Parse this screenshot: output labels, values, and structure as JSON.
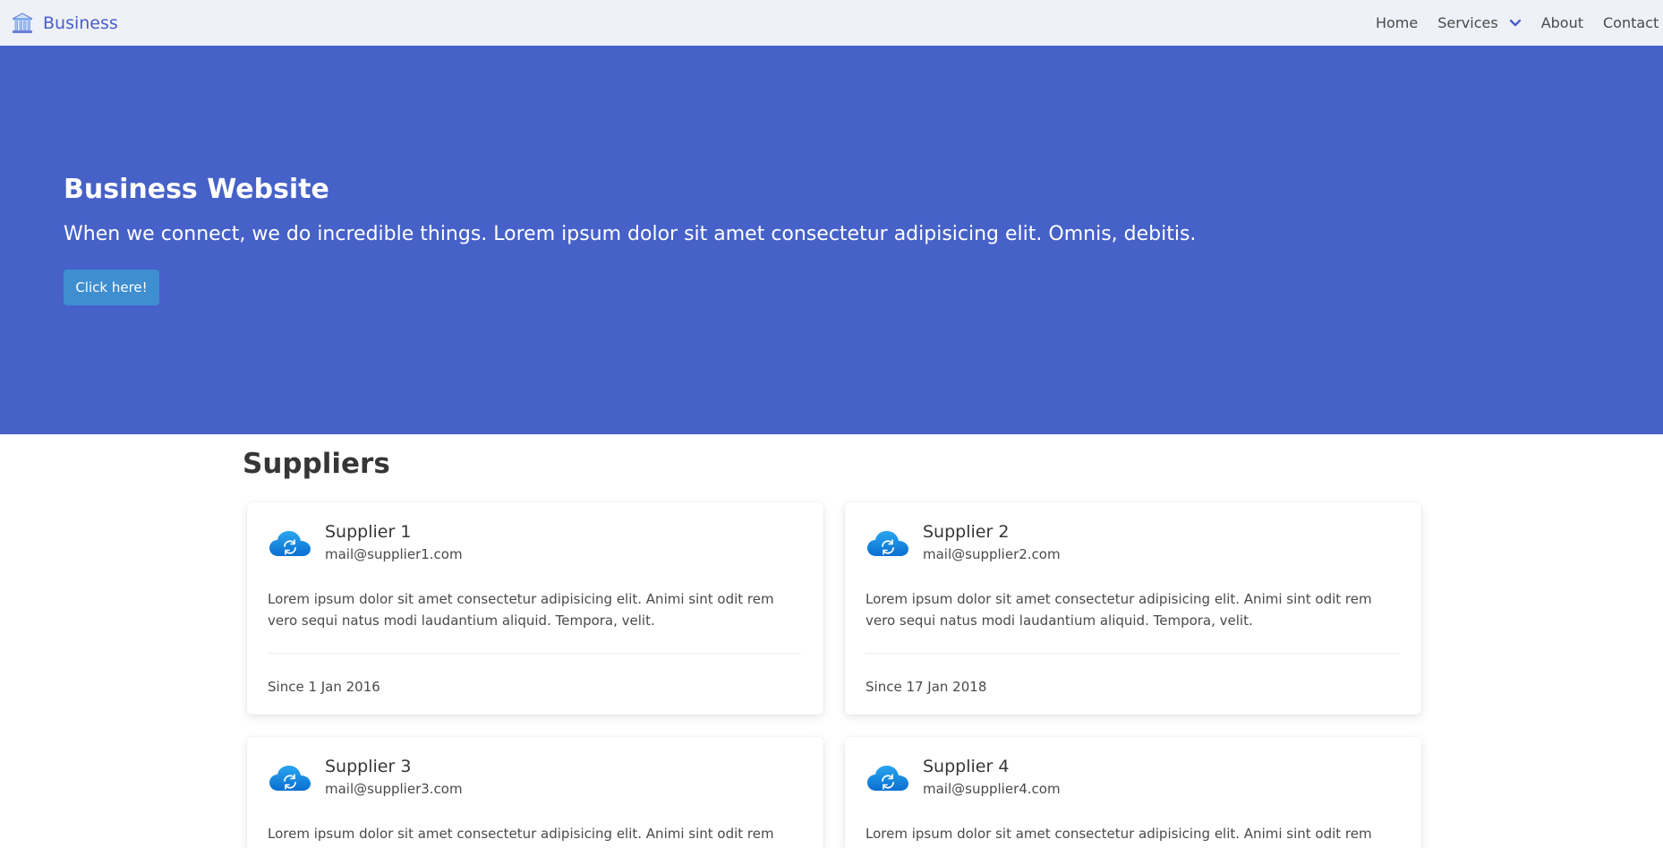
{
  "navbar": {
    "brand": "Business",
    "items": [
      {
        "label": "Home"
      },
      {
        "label": "Services"
      },
      {
        "label": "About"
      },
      {
        "label": "Contact"
      }
    ]
  },
  "hero": {
    "title": "Business Website",
    "subtitle": "When we connect, we do incredible things. Lorem ipsum dolor sit amet consectetur adipisicing elit. Omnis, debitis.",
    "button_label": "Click here!"
  },
  "suppliers": {
    "title": "Suppliers",
    "cards": [
      {
        "name": "Supplier 1",
        "email": "mail@supplier1.com",
        "description": "Lorem ipsum dolor sit amet consectetur adipisicing elit. Animi sint odit rem vero sequi natus modi laudantium aliquid. Tempora, velit.",
        "since": "Since 1 Jan 2016"
      },
      {
        "name": "Supplier 2",
        "email": "mail@supplier2.com",
        "description": "Lorem ipsum dolor sit amet consectetur adipisicing elit. Animi sint odit rem vero sequi natus modi laudantium aliquid. Tempora, velit.",
        "since": "Since 17 Jan 2018"
      },
      {
        "name": "Supplier 3",
        "email": "mail@supplier3.com",
        "description": "Lorem ipsum dolor sit amet consectetur adipisicing elit. Animi sint odit rem vero sequi natus modi laudantium aliquid. Tempora, velit."
      },
      {
        "name": "Supplier 4",
        "email": "mail@supplier4.com",
        "description": "Lorem ipsum dolor sit amet consectetur adipisicing elit. Animi sint odit rem vero sequi natus modi laudantium aliquid. Tempora, velit."
      }
    ]
  },
  "icons": {
    "brand": "building-icon",
    "services_dropdown": "chevron-down-icon",
    "supplier": "cloud-sync-icon"
  },
  "colors": {
    "brand": "#485fc7",
    "hero_background": "#4661c8",
    "button": "#3e8ed0",
    "navbar_background": "#eff1f8"
  }
}
